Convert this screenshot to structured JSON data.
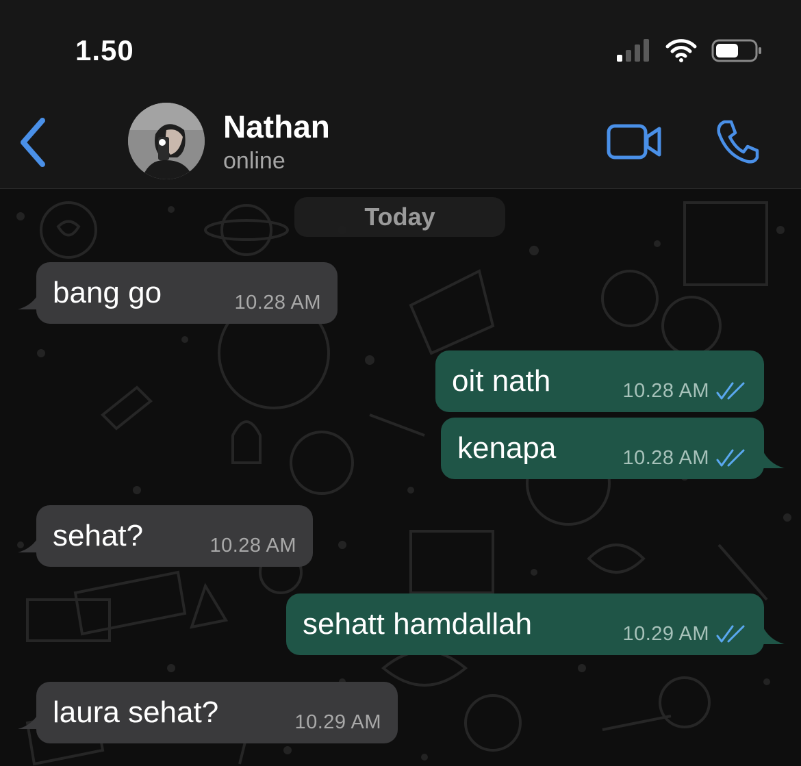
{
  "status_bar": {
    "time": "1.50"
  },
  "header": {
    "contact_name": "Nathan",
    "contact_status": "online"
  },
  "chat": {
    "date_label": "Today",
    "messages": [
      {
        "direction": "incoming",
        "text": "bang go",
        "time": "10.28 AM"
      },
      {
        "direction": "outgoing",
        "text": "oit nath",
        "time": "10.28 AM",
        "read": true
      },
      {
        "direction": "outgoing",
        "text": "kenapa",
        "time": "10.28 AM",
        "read": true
      },
      {
        "direction": "incoming",
        "text": "sehat?",
        "time": "10.28 AM"
      },
      {
        "direction": "outgoing",
        "text": "sehatt hamdallah",
        "time": "10.29 AM",
        "read": true
      },
      {
        "direction": "incoming",
        "text": "laura sehat?",
        "time": "10.29 AM"
      }
    ]
  },
  "colors": {
    "accent": "#4a90e8",
    "incoming_bubble": "#3a3a3c",
    "outgoing_bubble": "#1f5547",
    "read_ticks": "#5aa8f0"
  },
  "icons": [
    "cellular-signal-icon",
    "wifi-icon",
    "battery-icon",
    "back-chevron-icon",
    "video-call-icon",
    "phone-call-icon",
    "double-check-icon"
  ]
}
